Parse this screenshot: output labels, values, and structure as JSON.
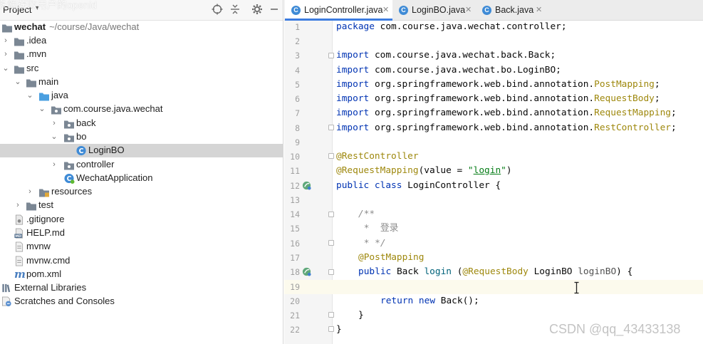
{
  "overlay_text": "多端获取用户的openid",
  "project_panel": {
    "title": "Project",
    "root": {
      "name": "wechat",
      "path": "~/course/Java/wechat"
    },
    "items": [
      {
        "label": ".idea"
      },
      {
        "label": ".mvn"
      },
      {
        "label": "src"
      },
      {
        "label": "main"
      },
      {
        "label": "java"
      },
      {
        "label": "com.course.java.wechat"
      },
      {
        "label": "back"
      },
      {
        "label": "bo"
      },
      {
        "label": "LoginBO"
      },
      {
        "label": "controller"
      },
      {
        "label": "WechatApplication"
      },
      {
        "label": "resources"
      },
      {
        "label": "test"
      },
      {
        "label": ".gitignore"
      },
      {
        "label": "HELP.md"
      },
      {
        "label": "mvnw"
      },
      {
        "label": "mvnw.cmd"
      },
      {
        "label": "pom.xml"
      },
      {
        "label": "External Libraries"
      },
      {
        "label": "Scratches and Consoles"
      }
    ]
  },
  "editor": {
    "tabs": [
      {
        "label": "LoginController.java",
        "active": true
      },
      {
        "label": "LoginBO.java",
        "active": false
      },
      {
        "label": "Back.java",
        "active": false
      }
    ],
    "line_numbers": [
      "1",
      "2",
      "3",
      "4",
      "5",
      "6",
      "7",
      "8",
      "9",
      "10",
      "11",
      "12",
      "13",
      "14",
      "15",
      "16",
      "17",
      "18",
      "19",
      "20",
      "21",
      "22"
    ],
    "code": {
      "l1_kw": "package",
      "l1_rest": " com.course.java.wechat.controller;",
      "l3_kw": "import",
      "l3_rest": " com.course.java.wechat.back.Back;",
      "l4_kw": "import",
      "l4_rest": " com.course.java.wechat.bo.LoginBO;",
      "l5_kw": "import",
      "l5_pkg": " org.springframework.web.bind.annotation.",
      "l5_cls": "PostMapping",
      "l5_end": ";",
      "l6_kw": "import",
      "l6_pkg": " org.springframework.web.bind.annotation.",
      "l6_cls": "RequestBody",
      "l6_end": ";",
      "l7_kw": "import",
      "l7_pkg": " org.springframework.web.bind.annotation.",
      "l7_cls": "RequestMapping",
      "l7_end": ";",
      "l8_kw": "import",
      "l8_pkg": " org.springframework.web.bind.annotation.",
      "l8_cls": "RestController",
      "l8_end": ";",
      "l10_ann": "@RestController",
      "l11_ann": "@RequestMapping",
      "l11_mid": "(value = ",
      "l11_str_q1": "\"",
      "l11_str": "login",
      "l11_str_q2": "\"",
      "l11_end": ")",
      "l12_kw": "public class",
      "l12_rest": " LoginController {",
      "l14_com": "/**",
      "l15_com": " *  登录",
      "l16_com": " * */",
      "l17_ann": "@PostMapping",
      "l18_kw": "public",
      "l18_type": " Back ",
      "l18_name": "login",
      "l18_open": " (",
      "l18_ann": "@RequestBody",
      "l18_ptype": " LoginBO ",
      "l18_param": "loginBO",
      "l18_close": ") {",
      "l20_kw": "return new",
      "l20_rest": " Back();",
      "l21": "}",
      "l22": "}"
    }
  },
  "watermark": "CSDN @qq_43433138",
  "colors": {
    "keyword": "#0033b3",
    "annotation": "#9e880d",
    "string": "#067d17",
    "comment": "#8c8c8c",
    "selection": "#d5d5d5",
    "active_tab_underline": "#3c7ce0"
  }
}
